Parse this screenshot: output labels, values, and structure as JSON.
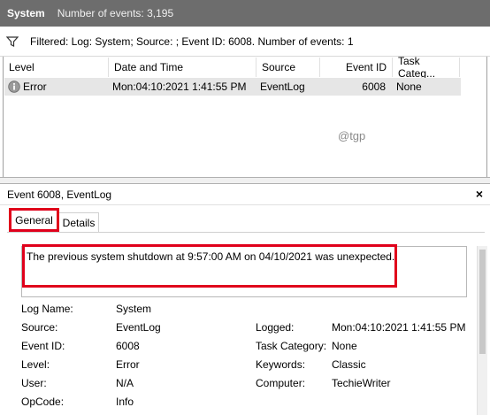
{
  "title_bar": {
    "log_name": "System",
    "count_text": "Number of events: 3,195"
  },
  "filter_bar": {
    "icon": "filter-icon",
    "text": "Filtered: Log: System; Source: ; Event ID: 6008. Number of events: 1"
  },
  "event_list": {
    "columns": [
      "Level",
      "Date and Time",
      "Source",
      "Event ID",
      "Task Categ..."
    ],
    "rows": [
      {
        "level_icon": "info-icon",
        "level": "Error",
        "date_time": "Mon:04:10:2021 1:41:55 PM",
        "source": "EventLog",
        "event_id": "6008",
        "task_category": "None"
      }
    ]
  },
  "watermark": "@tgp",
  "detail": {
    "header": "Event 6008, EventLog",
    "close": "×",
    "tabs": [
      "General",
      "Details"
    ],
    "description": "The previous system shutdown at 9:57:00 AM on 04/10/2021 was unexpected.",
    "props": {
      "log_name_label": "Log Name:",
      "log_name": "System",
      "source_label": "Source:",
      "source": "EventLog",
      "logged_label": "Logged:",
      "logged": "Mon:04:10:2021 1:41:55 PM",
      "event_id_label": "Event ID:",
      "event_id": "6008",
      "task_category_label": "Task Category:",
      "task_category": "None",
      "level_label": "Level:",
      "level": "Error",
      "keywords_label": "Keywords:",
      "keywords": "Classic",
      "user_label": "User:",
      "user": "N/A",
      "computer_label": "Computer:",
      "computer": "TechieWriter",
      "opcode_label": "OpCode:",
      "opcode": "Info"
    }
  },
  "colors": {
    "title_bg": "#6d6d6d",
    "highlight": "#e0001b",
    "row_selected": "#e6e6e6"
  }
}
